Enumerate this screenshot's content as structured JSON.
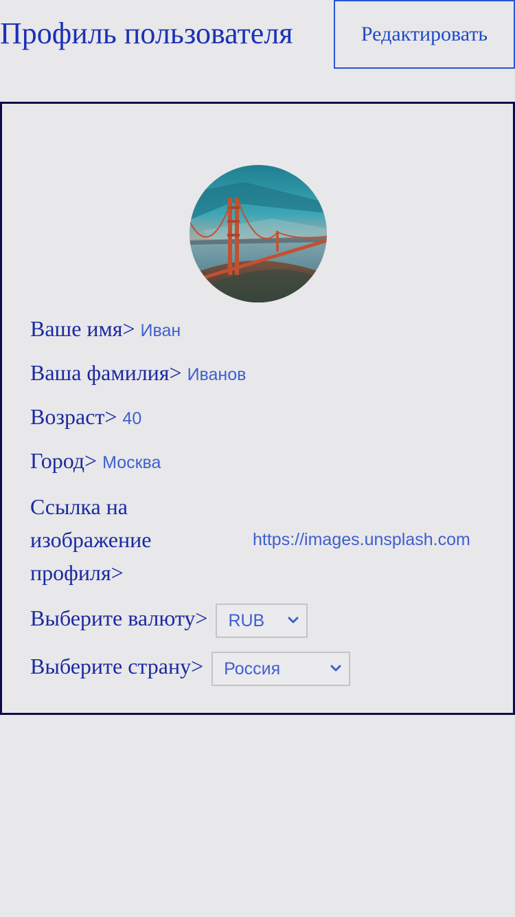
{
  "header": {
    "title": "Профиль пользователя",
    "edit_label": "Редактировать"
  },
  "profile": {
    "name_label": "Ваше имя>",
    "name_value": "Иван",
    "surname_label": "Ваша фамилия>",
    "surname_value": "Иванов",
    "age_label": "Возраст>",
    "age_value": "40",
    "city_label": "Город>",
    "city_value": "Москва",
    "image_link_label": "Ссылка на изображение профиля>",
    "image_link_value": "https://images.unsplash.com",
    "currency_label": "Выберите валюту>",
    "currency_selected": "RUB",
    "country_label": "Выберите страну>",
    "country_selected": "Россия"
  },
  "icons": {
    "avatar": "golden-gate-bridge-photo",
    "select_arrow": "chevron-down-icon"
  },
  "colors": {
    "background": "#e8e7ea",
    "title": "#1a32b4",
    "button_border": "#2a55d6",
    "card_border": "#0c0c4a",
    "label": "#1a2aa0",
    "value": "#3d5fd0"
  }
}
